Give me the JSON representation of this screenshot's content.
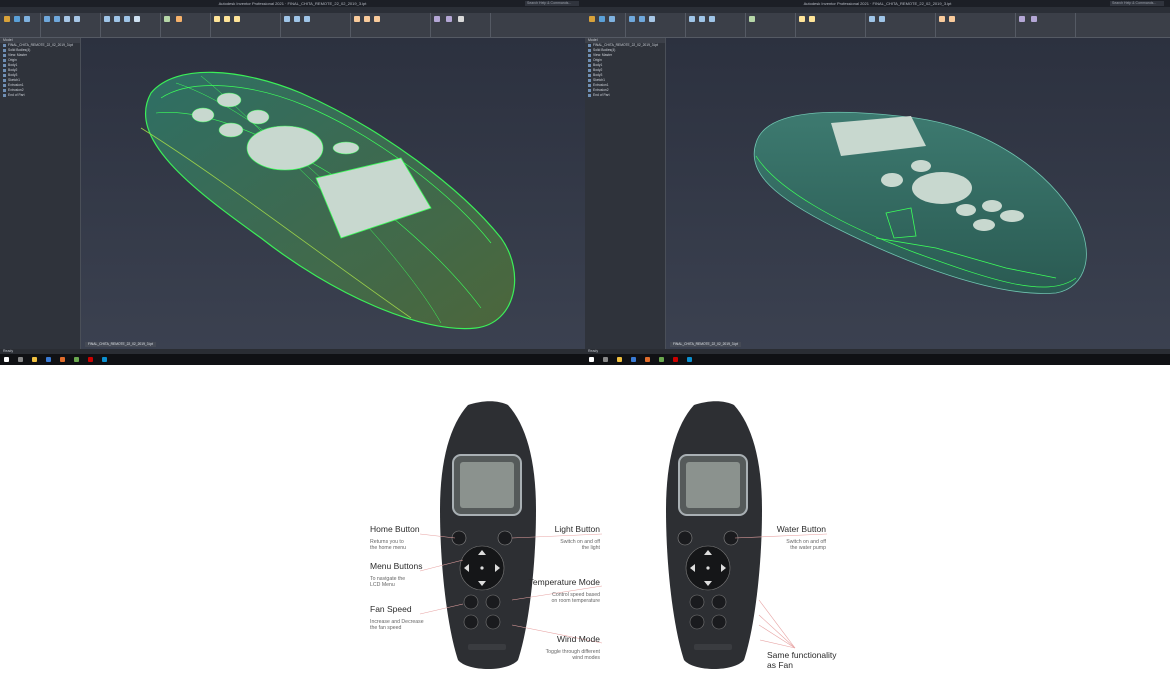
{
  "app": {
    "title": "Autodesk Inventor Professional 2021 · FINAL_CHITA_REMOTE_22_02_2019_3.ipt",
    "search_placeholder": "Search Help & Commands..."
  },
  "tabs": [
    "File",
    "3D Model",
    "Sketch",
    "Annotate",
    "Inspect",
    "Tools",
    "Manage",
    "View",
    "Environments",
    "Get Started",
    "Collaborate",
    "Vault",
    "Electromechanical"
  ],
  "browser": {
    "header": "Model",
    "left_nodes": [
      "FINAL_CHITA_REMOTE_22_02_2019_3.ipt",
      "Solid Bodies(4)",
      "View: Master",
      "Origin",
      "Body1",
      "Body2",
      "Body3",
      "Sketch1",
      "Extrusion1",
      "Extrusion2",
      "End of Part"
    ],
    "right_nodes": [
      "FINAL_CHITA_REMOTE_22_02_2019_3.ipt",
      "Solid Bodies(4)",
      "View: Master",
      "Origin",
      "Body1",
      "Body2",
      "Body3",
      "Sketch1",
      "Extrusion1",
      "Extrusion2",
      "End of Part"
    ]
  },
  "viewport": {
    "doc_tab": "FINAL_CHITA_REMOTE_22_02_2019_3.ipt"
  },
  "statusbar": {
    "text": "Ready"
  },
  "colors": {
    "ui_bg": "#2a2f3d",
    "ribbon": "#3b3f48",
    "file_tab": "#e36c17",
    "wire": "#3cff5a",
    "body": "#2f6b62",
    "button": "#c8d8cf"
  },
  "labels": {
    "home_title": "Home Button",
    "home_desc": "Returns you to\nthe home menu",
    "menu_title": "Menu Buttons",
    "menu_desc": "To navigate the\nLCD Menu",
    "fan_title": "Fan Speed",
    "fan_desc": "Increase and Decrease\nthe fan speed",
    "light_title": "Light Button",
    "light_desc": "Switch on and off\nthe light",
    "temp_title": "Temperature Mode",
    "temp_desc": "Control speed based\non room temperature",
    "wind_title": "Wind Mode",
    "wind_desc": "Toggle through different\nwind modes",
    "water_title": "Water Button",
    "water_desc": "Switch on and off\nthe water pump",
    "same_title": "Same functionality\nas Fan"
  }
}
